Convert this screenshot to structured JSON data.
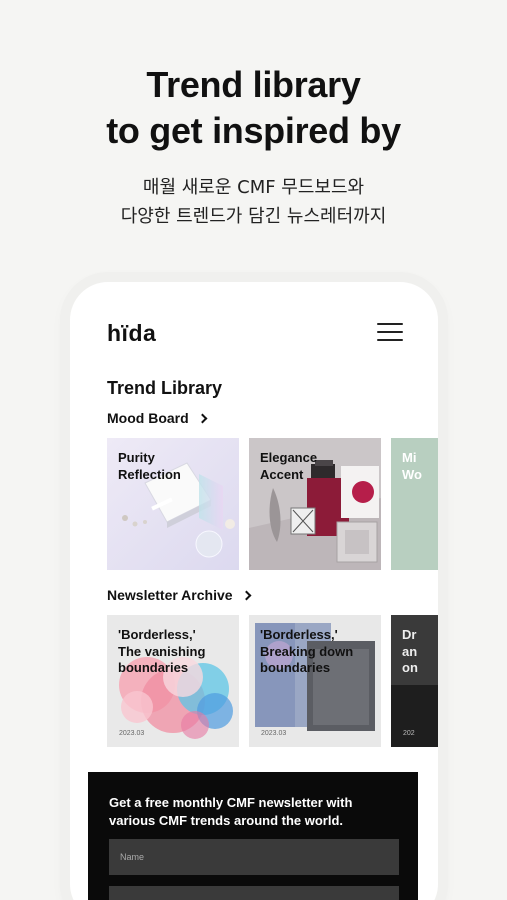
{
  "hero": {
    "title_line1": "Trend library",
    "title_line2": "to get inspired by",
    "subtitle_line1": "매월 새로운 CMF 무드보드와",
    "subtitle_line2": "다양한 트렌드가 담긴 뉴스레터까지"
  },
  "app": {
    "logo": "hïda",
    "menu_icon": "hamburger-menu-icon",
    "section_title": "Trend Library",
    "mood_board": {
      "label": "Mood Board",
      "cards": [
        {
          "label": "Purity\nReflection"
        },
        {
          "label": "Elegance\nAccent"
        },
        {
          "label": "Mi\nWo"
        }
      ]
    },
    "newsletter": {
      "label": "Newsletter Archive",
      "cards": [
        {
          "label": "'Borderless,'\nThe vanishing\nboundaries",
          "date": "2023.03"
        },
        {
          "label": "'Borderless,'\nBreaking down\nboundaries",
          "date": "2023.03"
        },
        {
          "label": "Dr\nan\non",
          "date": "202"
        }
      ]
    },
    "cta": {
      "text": "Get a free monthly CMF newsletter with various CMF trends around the world.",
      "name_placeholder": "Name",
      "email_placeholder": ""
    }
  },
  "colors": {
    "background": "#f5f5f3",
    "cta_background": "#0a0a0a",
    "input_background": "#3a3a3a"
  }
}
